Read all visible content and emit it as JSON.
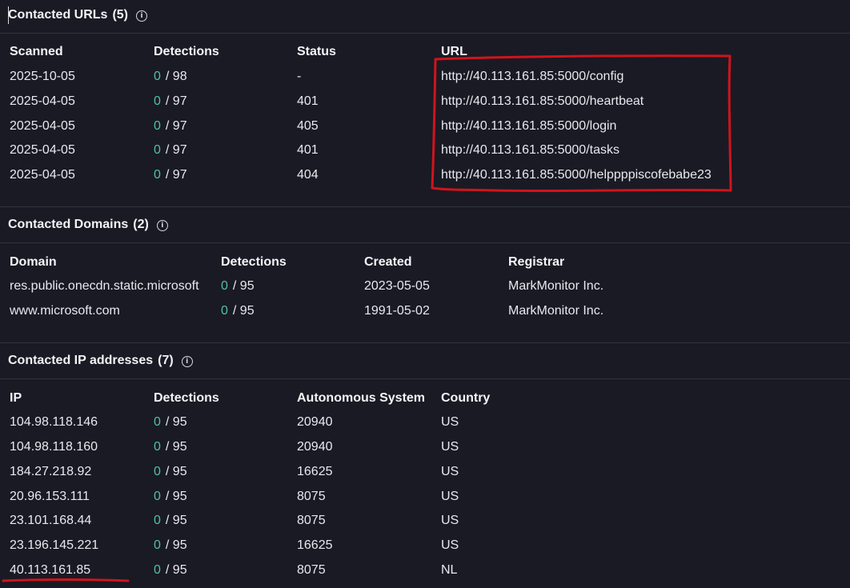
{
  "urls": {
    "title": "Contacted URLs",
    "count": "(5)",
    "headers": [
      "Scanned",
      "Detections",
      "Status",
      "URL"
    ],
    "rows": [
      {
        "scanned": "2025-10-05",
        "det_zero": "0",
        "det_total": "/ 98",
        "status": "-",
        "url": "http://40.113.161.85:5000/config"
      },
      {
        "scanned": "2025-04-05",
        "det_zero": "0",
        "det_total": "/ 97",
        "status": "401",
        "url": "http://40.113.161.85:5000/heartbeat"
      },
      {
        "scanned": "2025-04-05",
        "det_zero": "0",
        "det_total": "/ 97",
        "status": "405",
        "url": "http://40.113.161.85:5000/login"
      },
      {
        "scanned": "2025-04-05",
        "det_zero": "0",
        "det_total": "/ 97",
        "status": "401",
        "url": "http://40.113.161.85:5000/tasks"
      },
      {
        "scanned": "2025-04-05",
        "det_zero": "0",
        "det_total": "/ 97",
        "status": "404",
        "url": "http://40.113.161.85:5000/helppppiscofebabe23"
      }
    ]
  },
  "domains": {
    "title": "Contacted Domains",
    "count": "(2)",
    "headers": [
      "Domain",
      "Detections",
      "Created",
      "Registrar"
    ],
    "rows": [
      {
        "domain": "res.public.onecdn.static.microsoft",
        "det_zero": "0",
        "det_total": "/ 95",
        "created": "2023-05-05",
        "registrar": "MarkMonitor Inc."
      },
      {
        "domain": "www.microsoft.com",
        "det_zero": "0",
        "det_total": "/ 95",
        "created": "1991-05-02",
        "registrar": "MarkMonitor Inc."
      }
    ]
  },
  "ips": {
    "title": "Contacted IP addresses",
    "count": "(7)",
    "headers": [
      "IP",
      "Detections",
      "Autonomous System",
      "Country"
    ],
    "rows": [
      {
        "ip": "104.98.118.146",
        "det_zero": "0",
        "det_total": "/ 95",
        "as": "20940",
        "country": "US"
      },
      {
        "ip": "104.98.118.160",
        "det_zero": "0",
        "det_total": "/ 95",
        "as": "20940",
        "country": "US"
      },
      {
        "ip": "184.27.218.92",
        "det_zero": "0",
        "det_total": "/ 95",
        "as": "16625",
        "country": "US"
      },
      {
        "ip": "20.96.153.111",
        "det_zero": "0",
        "det_total": "/ 95",
        "as": "8075",
        "country": "US"
      },
      {
        "ip": "23.101.168.44",
        "det_zero": "0",
        "det_total": "/ 95",
        "as": "8075",
        "country": "US"
      },
      {
        "ip": "23.196.145.221",
        "det_zero": "0",
        "det_total": "/ 95",
        "as": "16625",
        "country": "US"
      },
      {
        "ip": "40.113.161.85",
        "det_zero": "0",
        "det_total": "/ 95",
        "as": "8075",
        "country": "NL"
      }
    ]
  },
  "info_icon": "info-icon",
  "colors": {
    "background": "#1a1a24",
    "detection_zero": "#4fc1a6",
    "annotation": "#d0141c"
  }
}
